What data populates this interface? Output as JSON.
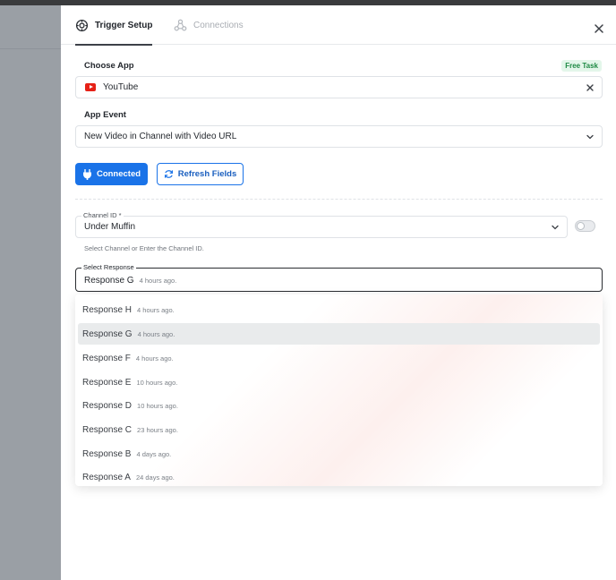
{
  "tabs": {
    "trigger_setup": "Trigger Setup",
    "connections": "Connections"
  },
  "choose_app": {
    "label": "Choose App",
    "badge": "Free Task",
    "value": "YouTube"
  },
  "app_event": {
    "label": "App Event",
    "value": "New Video in Channel with Video URL"
  },
  "buttons": {
    "connected": "Connected",
    "refresh": "Refresh Fields"
  },
  "channel": {
    "label": "Channel ID *",
    "value": "Under Muffin",
    "helper": "Select Channel or Enter the Channel ID."
  },
  "select_response": {
    "label": "Select Response",
    "value": "Response G",
    "value_time": "4 hours ago."
  },
  "options": [
    {
      "label": "Response H",
      "time": "4 hours ago."
    },
    {
      "label": "Response G",
      "time": "4 hours ago.",
      "selected": true
    },
    {
      "label": "Response F",
      "time": "4 hours ago."
    },
    {
      "label": "Response E",
      "time": "10 hours ago."
    },
    {
      "label": "Response D",
      "time": "10 hours ago."
    },
    {
      "label": "Response C",
      "time": "23 hours ago."
    },
    {
      "label": "Response B",
      "time": "4 days ago."
    },
    {
      "label": "Response A",
      "time": "24 days ago."
    }
  ],
  "colors": {
    "primary": "#1a73e8",
    "badge_green": "#1f8a45",
    "youtube_red": "#e62117"
  },
  "icons": {
    "trigger_tab": "gear-icon",
    "connections_tab": "connections-icon",
    "close": "close-icon",
    "app": "youtube-icon",
    "clear": "clear-icon",
    "dropdown": "chevron-down-icon",
    "connected": "plug-icon",
    "refresh": "refresh-icon"
  }
}
